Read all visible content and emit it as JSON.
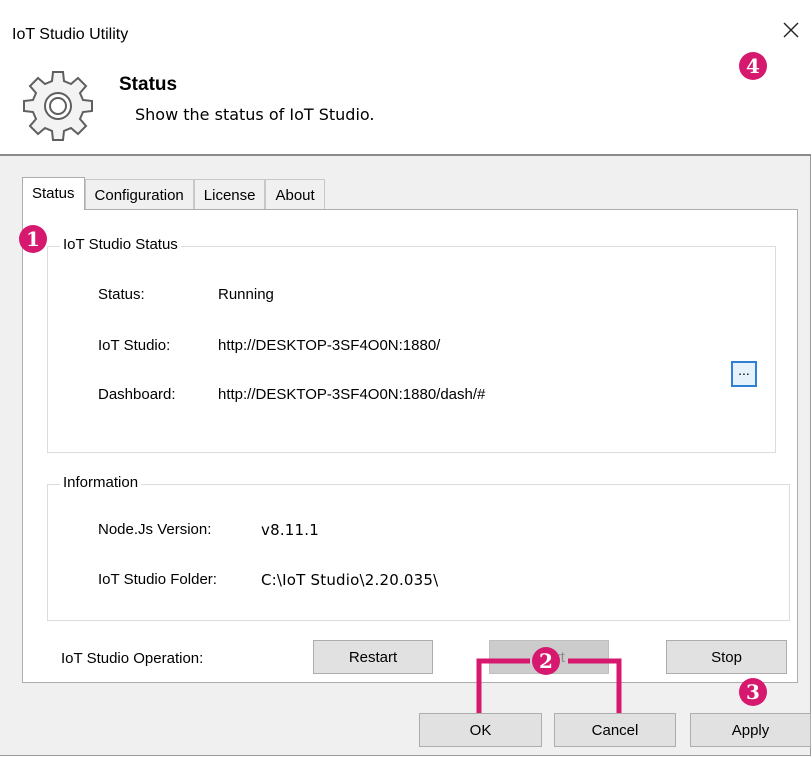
{
  "window": {
    "title": "IoT Studio Utility"
  },
  "header": {
    "title": "Status",
    "description": "Show the status of IoT Studio."
  },
  "tabs": [
    {
      "label": "Status",
      "active": true
    },
    {
      "label": "Configuration",
      "active": false
    },
    {
      "label": "License",
      "active": false
    },
    {
      "label": "About",
      "active": false
    }
  ],
  "status_group": {
    "title": "IoT Studio Status",
    "status_label": "Status:",
    "status_value": "Running",
    "studio_label": "IoT Studio:",
    "studio_value": "http://DESKTOP-3SF4O0N:1880/",
    "dashboard_label": "Dashboard:",
    "dashboard_value": "http://DESKTOP-3SF4O0N:1880/dash/#"
  },
  "info_group": {
    "title": "Information",
    "node_label": "Node.Js Version:",
    "node_value": "v8.11.1",
    "folder_label": "IoT Studio Folder:",
    "folder_value": "C:\\IoT Studio\\2.20.035\\",
    "browse_label": "..."
  },
  "operation": {
    "label": "IoT Studio Operation:",
    "restart": "Restart",
    "start": "Start",
    "stop": "Stop"
  },
  "footer": {
    "ok": "OK",
    "cancel": "Cancel",
    "apply": "Apply"
  },
  "callouts": {
    "one": "1",
    "two": "2",
    "three": "3",
    "four": "4"
  },
  "colors": {
    "callout": "#d6186e",
    "focus": "#2f7fd4"
  }
}
